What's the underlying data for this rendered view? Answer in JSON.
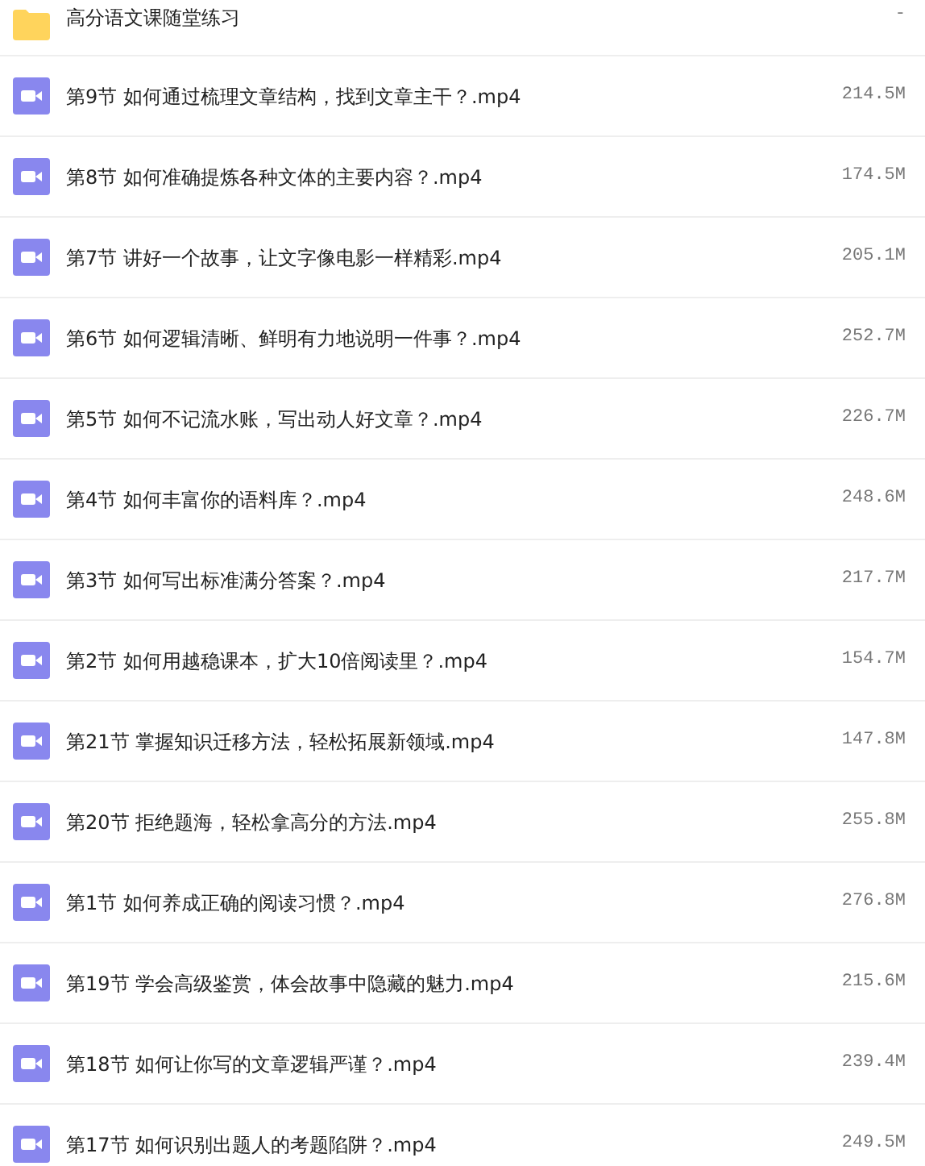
{
  "files": [
    {
      "kind": "folder",
      "name": "高分语文课随堂练习",
      "size": "-"
    },
    {
      "kind": "video",
      "name": "第9节 如何通过梳理文章结构，找到文章主干？.mp4",
      "size": "214.5M"
    },
    {
      "kind": "video",
      "name": "第8节 如何准确提炼各种文体的主要内容？.mp4",
      "size": "174.5M"
    },
    {
      "kind": "video",
      "name": "第7节 讲好一个故事，让文字像电影一样精彩.mp4",
      "size": "205.1M"
    },
    {
      "kind": "video",
      "name": "第6节 如何逻辑清晰、鲜明有力地说明一件事？.mp4",
      "size": "252.7M"
    },
    {
      "kind": "video",
      "name": "第5节 如何不记流水账，写出动人好文章？.mp4",
      "size": "226.7M"
    },
    {
      "kind": "video",
      "name": "第4节 如何丰富你的语料库？.mp4",
      "size": "248.6M"
    },
    {
      "kind": "video",
      "name": "第3节 如何写出标准满分答案？.mp4",
      "size": "217.7M"
    },
    {
      "kind": "video",
      "name": "第2节 如何用越稳课本，扩大10倍阅读里？.mp4",
      "size": "154.7M"
    },
    {
      "kind": "video",
      "name": "第21节 掌握知识迁移方法，轻松拓展新领域.mp4",
      "size": "147.8M"
    },
    {
      "kind": "video",
      "name": "第20节 拒绝题海，轻松拿高分的方法.mp4",
      "size": "255.8M"
    },
    {
      "kind": "video",
      "name": "第1节 如何养成正确的阅读习惯？.mp4",
      "size": "276.8M"
    },
    {
      "kind": "video",
      "name": "第19节 学会高级鉴赏，体会故事中隐藏的魅力.mp4",
      "size": "215.6M"
    },
    {
      "kind": "video",
      "name": "第18节 如何让你写的文章逻辑严谨？.mp4",
      "size": "239.4M"
    },
    {
      "kind": "video",
      "name": "第17节 如何识别出题人的考题陷阱？.mp4",
      "size": "249.5M"
    }
  ]
}
